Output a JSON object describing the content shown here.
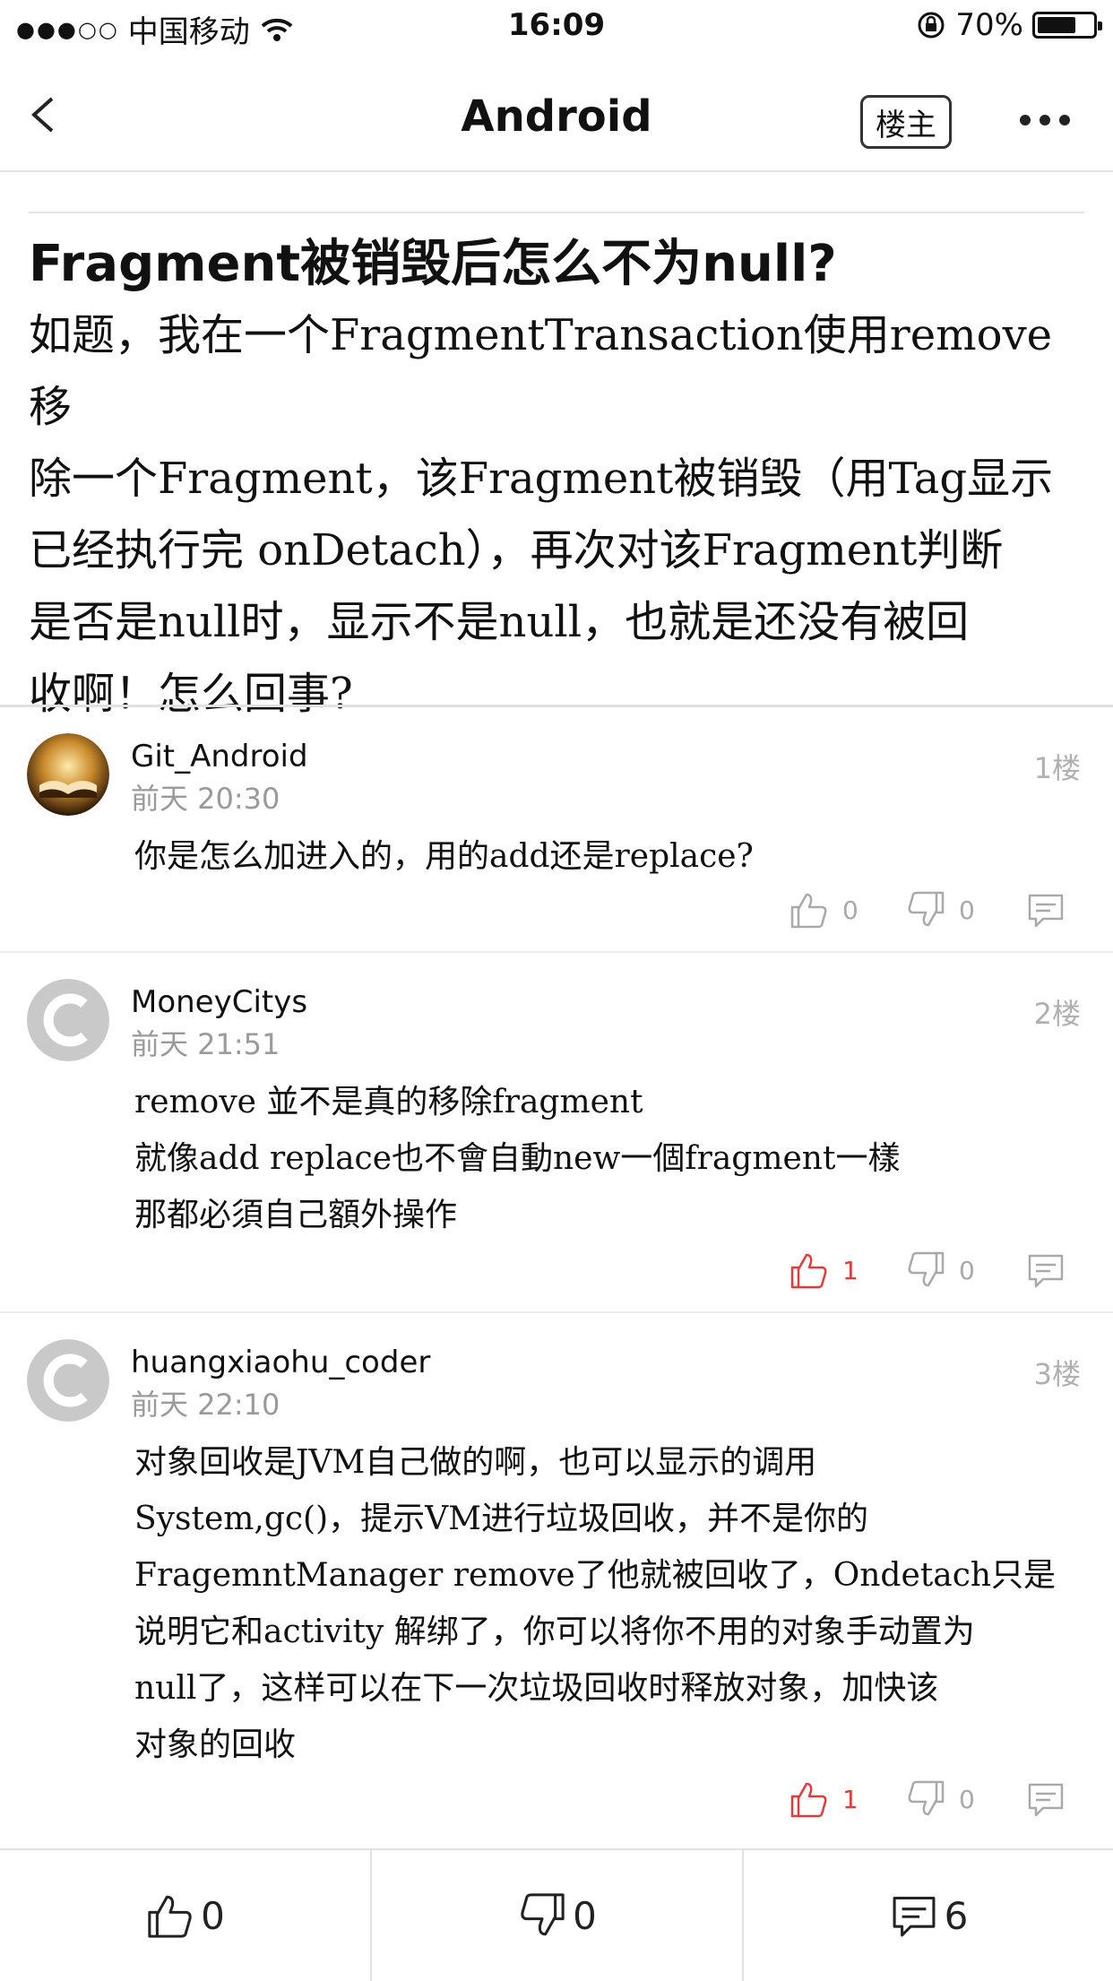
{
  "status_bar": {
    "carrier": "中国移动",
    "time": "16:09",
    "battery": "70%",
    "battery_level": 0.7
  },
  "nav": {
    "title": "Android",
    "owner_label": "楼主"
  },
  "question": {
    "title": "Fragment被销毁后怎么不为null?",
    "body_lines": [
      "如题，我在一个FragmentTransaction使用remove移",
      "除一个Fragment，该Fragment被销毁（用Tag显示",
      "已经执行完 onDetach），再次对该Fragment判断",
      "是否是null时，显示不是null，也就是还没有被回",
      "收啊！怎么回事?"
    ]
  },
  "comments": [
    {
      "user": "Git_Android",
      "time": "前天 20:30",
      "floor": "1楼",
      "lines": [
        "你是怎么加进入的，用的add还是replace?"
      ],
      "likes": "0",
      "dislikes": "0",
      "liked": false
    },
    {
      "user": "MoneyCitys",
      "time": "前天 21:51",
      "floor": "2楼",
      "lines": [
        "remove 並不是真的移除fragment",
        "就像add  replace也不會自動new一個fragment一樣",
        "那都必須自己額外操作"
      ],
      "likes": "1",
      "dislikes": "0",
      "liked": true
    },
    {
      "user": "huangxiaohu_coder",
      "time": "前天 22:10",
      "floor": "3楼",
      "lines": [
        "对象回收是JVM自己做的啊，也可以显示的调用",
        "System,gc()，提示VM进行垃圾回收，并不是你的",
        "FragemntManager remove了他就被回收了，Ondetach只是",
        "说明它和activity 解绑了，你可以将你不用的对象手动置为",
        "null了，这样可以在下一次垃圾回收时释放对象，加快该",
        "对象的回收"
      ],
      "likes": "1",
      "dislikes": "0",
      "liked": true
    }
  ],
  "bottom_bar": {
    "likes": "0",
    "dislikes": "0",
    "comments": "6"
  },
  "colors": {
    "accent_red": "#e23b3b",
    "muted_gray": "#a9a9a9"
  }
}
